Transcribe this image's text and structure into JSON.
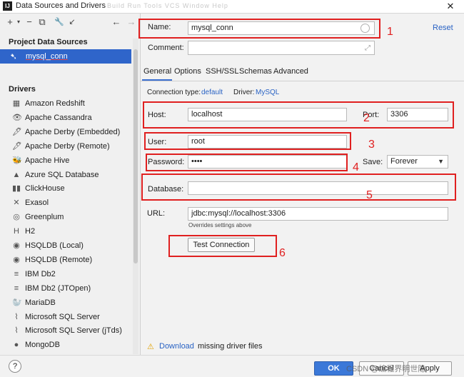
{
  "window": {
    "title": "Data Sources and Drivers",
    "ghost_menu": "Build  Run  Tools  VCS  Window  Help"
  },
  "left": {
    "project_title": "Project Data Sources",
    "selected_source": "mysql_conn",
    "drivers_title": "Drivers",
    "drivers": [
      {
        "label": "Amazon Redshift",
        "icon": "redshift-icon"
      },
      {
        "label": "Apache Cassandra",
        "icon": "cassandra-icon"
      },
      {
        "label": "Apache Derby (Embedded)",
        "icon": "derby-icon"
      },
      {
        "label": "Apache Derby (Remote)",
        "icon": "derby-icon"
      },
      {
        "label": "Apache Hive",
        "icon": "hive-icon"
      },
      {
        "label": "Azure SQL Database",
        "icon": "azure-icon"
      },
      {
        "label": "ClickHouse",
        "icon": "clickhouse-icon"
      },
      {
        "label": "Exasol",
        "icon": "exasol-icon"
      },
      {
        "label": "Greenplum",
        "icon": "greenplum-icon"
      },
      {
        "label": "H2",
        "icon": "h2-icon"
      },
      {
        "label": "HSQLDB (Local)",
        "icon": "hsqldb-icon"
      },
      {
        "label": "HSQLDB (Remote)",
        "icon": "hsqldb-icon"
      },
      {
        "label": "IBM Db2",
        "icon": "ibm-icon"
      },
      {
        "label": "IBM Db2 (JTOpen)",
        "icon": "ibm-icon"
      },
      {
        "label": "MariaDB",
        "icon": "mariadb-icon"
      },
      {
        "label": "Microsoft SQL Server",
        "icon": "mssql-icon"
      },
      {
        "label": "Microsoft SQL Server (jTds)",
        "icon": "mssql-icon"
      },
      {
        "label": "MongoDB",
        "icon": "mongodb-icon"
      }
    ]
  },
  "form": {
    "name_label": "Name:",
    "name_value": "mysql_conn",
    "reset_label": "Reset",
    "comment_label": "Comment:",
    "tabs": [
      "General",
      "Options",
      "SSH/SSL",
      "Schemas",
      "Advanced"
    ],
    "conn_type_label": "Connection type:",
    "conn_type_value": "default",
    "driver_label": "Driver:",
    "driver_value": "MySQL",
    "host_label": "Host:",
    "host_value": "localhost",
    "port_label": "Port:",
    "port_value": "3306",
    "user_label": "User:",
    "user_value": "root",
    "password_label": "Password:",
    "password_value": "••••",
    "save_label": "Save:",
    "save_value": "Forever",
    "database_label": "Database:",
    "url_label": "URL:",
    "url_value": "jdbc:mysql://localhost:3306",
    "url_hint": "Overrides settings above",
    "test_button": "Test Connection",
    "download_link": "Download",
    "download_text": "missing driver files"
  },
  "annotations": [
    "1",
    "2",
    "3",
    "4",
    "5",
    "6"
  ],
  "footer": {
    "help": "?",
    "ok": "OK",
    "cancel": "Cancel",
    "apply": "Apply",
    "watermark": "CSDN @编程界明世隐"
  },
  "colors": {
    "annotation_red": "#e02020",
    "selection_blue": "#2f65ca",
    "link_blue": "#2a63c4",
    "primary_button": "#3b78d8"
  }
}
